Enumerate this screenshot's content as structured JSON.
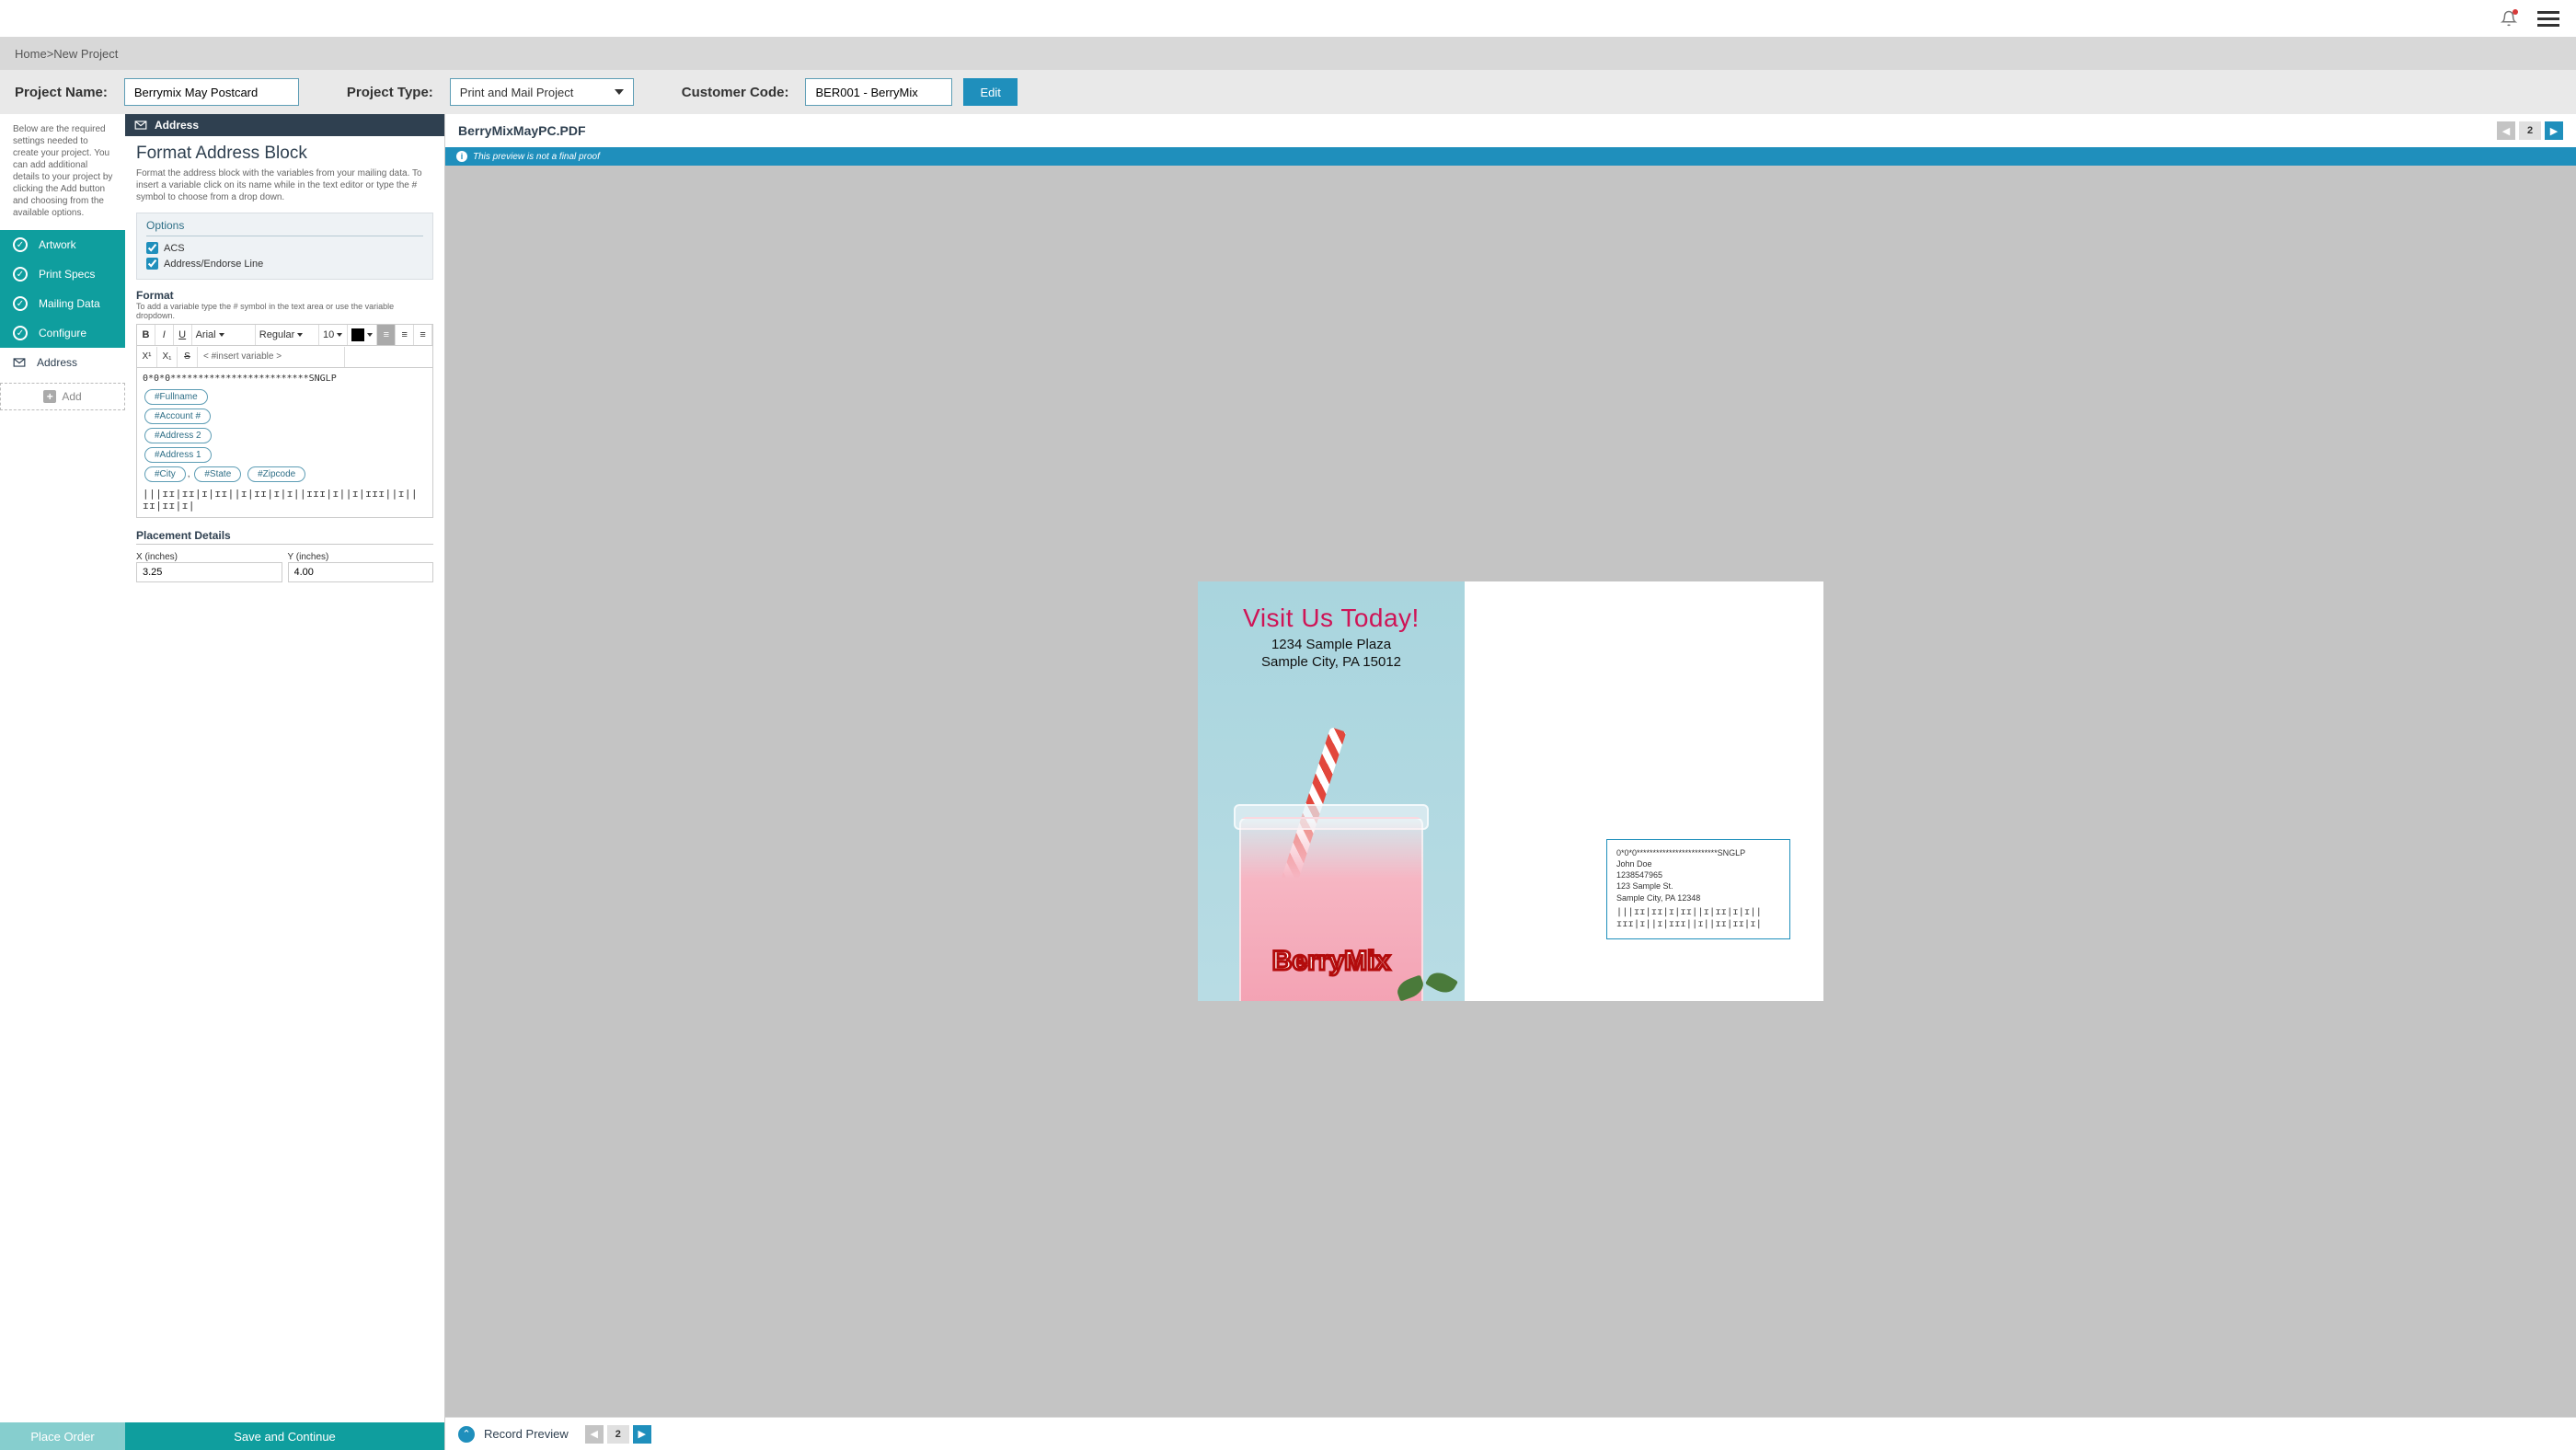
{
  "breadcrumb": {
    "home": "Home",
    "sep": " > ",
    "current": "New Project"
  },
  "projectbar": {
    "name_label": "Project Name:",
    "name_value": "Berrymix May Postcard",
    "type_label": "Project Type:",
    "type_value": "Print and Mail Project",
    "code_label": "Customer Code:",
    "code_value": "BER001 - BerryMix",
    "edit": "Edit"
  },
  "help_text": "Below are the required settings needed to create your project. You can add additional details to your project by clicking the Add button and choosing from the available options.",
  "steps": {
    "artwork": "Artwork",
    "print_specs": "Print Specs",
    "mailing_data": "Mailing Data",
    "configure": "Configure",
    "address": "Address"
  },
  "add_label": "Add",
  "place_order": "Place Order",
  "save_continue": "Save and Continue",
  "mid": {
    "header": "Address",
    "title": "Format Address Block",
    "desc": "Format the address block with the variables from your mailing data. To insert a variable click on its name while in the text editor or type the # symbol to choose from a drop down.",
    "options_hdr": "Options",
    "opt_acs": "ACS",
    "opt_endorse": "Address/Endorse Line",
    "format_hdr": "Format",
    "format_sub": "To add a variable type the # symbol in the text area or use the variable dropdown.",
    "font_family": "Arial",
    "font_weight": "Regular",
    "font_size": "10",
    "insert_var": "< #insert variable >",
    "editor_topline": "0*0*0*************************SNGLP",
    "chips": {
      "fullname": "#Fullname",
      "account": "#Account #",
      "address2": "#Address 2",
      "address1": "#Address 1",
      "city": "#City",
      "state": "#State",
      "zipcode": "#Zipcode"
    },
    "barcode": "|||ɪɪ|ɪɪ|ɪ|ɪɪ||ɪ|ɪɪ|ɪ|ɪ||ɪɪɪ|ɪ||ɪ|ɪɪɪ||ɪ||ɪɪ|ɪɪ|ɪ|",
    "placement_hdr": "Placement Details",
    "x_label": "X (inches)",
    "y_label": "Y (inches)",
    "x_value": "3.25",
    "y_value": "4.00"
  },
  "preview": {
    "filename": "BerryMixMayPC.PDF",
    "page_num": "2",
    "proof_msg": "This preview is not a final proof",
    "record_preview": "Record Preview",
    "record_num": "2",
    "postcard": {
      "headline": "Visit Us Today!",
      "addr1": "1234 Sample Plaza",
      "addr2": "Sample City, PA 15012",
      "brand": "BerryMix"
    },
    "address_block": {
      "line1": "0*0*0*************************SNGLP",
      "line2": "John Doe",
      "line3": "1238547965",
      "line4": "123 Sample St.",
      "line5": "Sample City, PA 12348",
      "barcode": "|||ɪɪ|ɪɪ|ɪ|ɪɪ||ɪ|ɪɪ|ɪ|ɪ||ɪɪɪ|ɪ||ɪ|ɪɪɪ||ɪ||ɪɪ|ɪɪ|ɪ|"
    }
  }
}
